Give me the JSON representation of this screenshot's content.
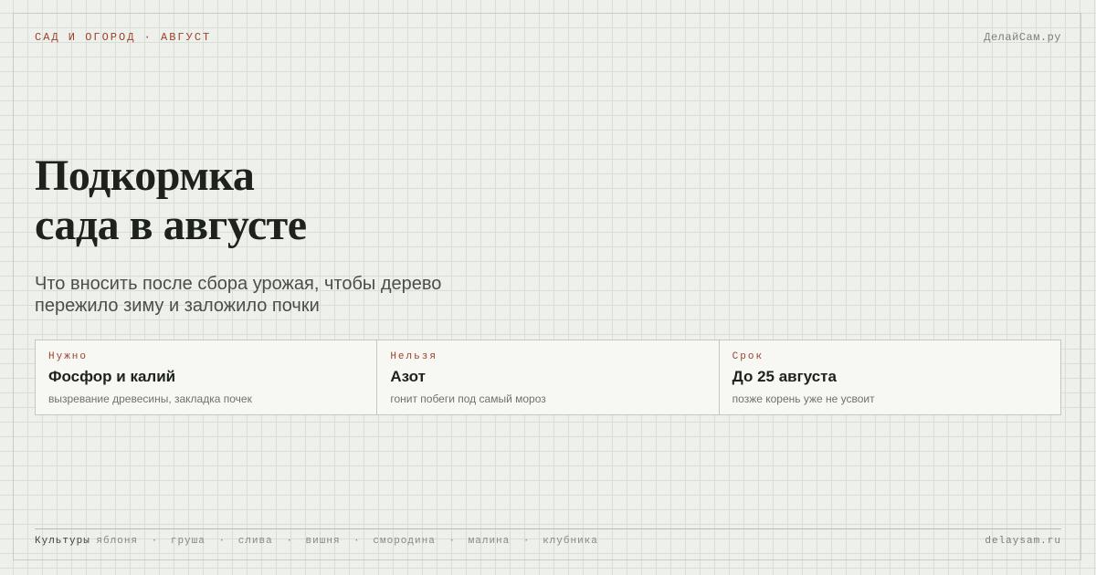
{
  "header": {
    "section": "САД И ОГОРОД · АВГУСТ",
    "brand": "ДелайСам.ру"
  },
  "title": {
    "line1": "Подкормка",
    "line2": "сада в августе"
  },
  "subtitle": "Что вносить после сбора урожая, чтобы дерево пережило зиму и заложило почки",
  "cards": [
    {
      "kicker": "Нужно",
      "title": "Фосфор и калий",
      "note": "вызревание древесины, закладка почек"
    },
    {
      "kicker": "Нельзя",
      "title": "Азот",
      "note": "гонит побеги под самый мороз"
    },
    {
      "kicker": "Срок",
      "title": "До 25 августа",
      "note": "позже корень уже не усвоит"
    }
  ],
  "footer": {
    "crops_label": "Культуры",
    "crops": [
      "яблоня",
      "груша",
      "слива",
      "вишня",
      "смородина",
      "малина",
      "клубника"
    ],
    "separator": "·",
    "site": "delaysam.ru"
  },
  "colors": {
    "background": "#eef0eb",
    "accent": "#a0402c",
    "ink": "#1d221c"
  }
}
